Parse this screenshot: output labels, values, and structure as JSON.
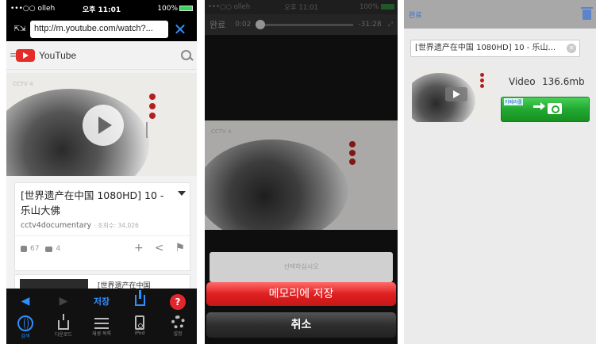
{
  "panel1": {
    "status": {
      "carrier": "•••○○ olleh",
      "time": "오후 11:01",
      "battery": "100%"
    },
    "url": "http://m.youtube.com/watch?...",
    "site_name": "YouTube",
    "video": {
      "title": "[世界遗产在中国 1080HD] 10 - 乐山大佛",
      "channel": "cctv4documentary",
      "views": "· 조회수: 34,026",
      "likes": "67",
      "comments": "4",
      "watermark": "CCTV 4"
    },
    "next_title": "[世界遗产在中国",
    "toolbar": {
      "save": "저장",
      "help": "?"
    },
    "tabs": [
      "검색",
      "다운로드",
      "재생 목록",
      "iPod",
      "설정"
    ]
  },
  "panel2": {
    "status": {
      "carrier": "•••○○ olleh",
      "time": "오후 11:01",
      "battery": "100%"
    },
    "done": "완료",
    "elapsed": "0:02",
    "remaining": "-31:28",
    "prompt": "선택하십시오",
    "save_memory": "메모리에 저장",
    "cancel": "취소"
  },
  "panel3": {
    "back": "완료",
    "title_field": "[世界遗产在中国 1080HD] 10 - 乐山...",
    "type": "Video",
    "size": "136.6mb",
    "camera_label": "카메라롤"
  },
  "colors": {
    "ios_blue": "#2f8fff",
    "youtube_red": "#e52d27",
    "action_red": "#e02020",
    "action_green": "#22a832"
  }
}
